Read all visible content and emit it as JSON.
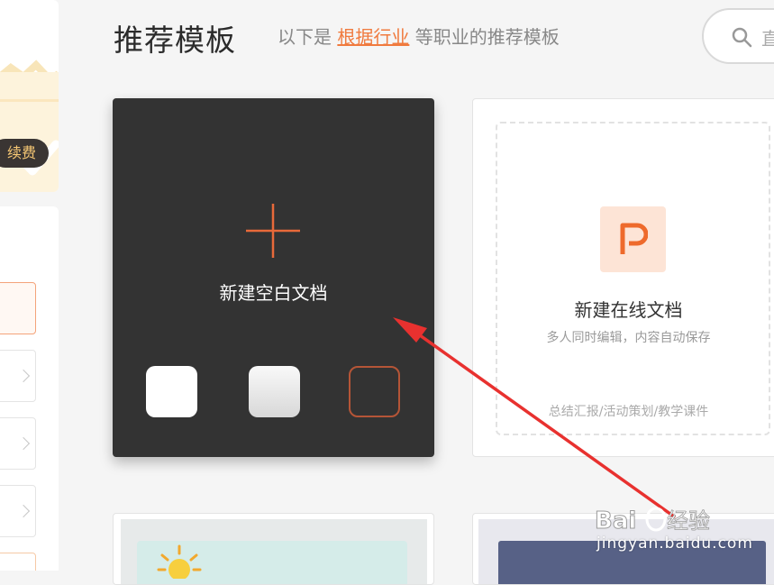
{
  "header": {
    "title": "推荐模板",
    "subtitle_prefix": "以下是",
    "subtitle_link": "根据行业",
    "subtitle_suffix": "等职业的推荐模板",
    "search_placeholder_partial": "直"
  },
  "sidebar": {
    "renew_badge": "续费"
  },
  "blank_doc_card": {
    "label": "新建空白文档",
    "swatches": [
      "white",
      "light-gray",
      "outline"
    ]
  },
  "online_doc_card": {
    "title": "新建在线文档",
    "description": "多人同时编辑，内容自动保存",
    "tags": "总结汇报/活动策划/教学课件"
  },
  "watermark": {
    "text": "jingyan.baidu.com",
    "logo": "Baidu经验"
  },
  "colors": {
    "accent": "#f07a3e",
    "card_dark": "#333333",
    "arrow": "#e8312f"
  }
}
